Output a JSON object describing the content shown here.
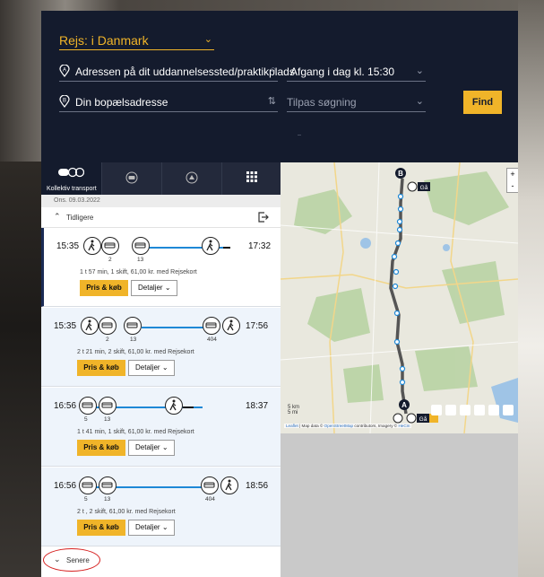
{
  "search": {
    "region_label": "Rejs: i Danmark",
    "from_placeholder": "Adressen på dit uddannelsessted/praktikplads",
    "time_label": "Afgang i dag kl. 15:30",
    "to_placeholder": "Din bopælsadresse",
    "refine_label": "Tilpas søgning",
    "find_label": "Find",
    "pin_a": "A",
    "pin_b": "B"
  },
  "tabs": [
    {
      "label": "Kollektiv transport",
      "icon": "public-transport-icon"
    },
    {
      "label": "",
      "icon": "car-icon"
    },
    {
      "label": "",
      "icon": "car-share-icon"
    },
    {
      "label": "",
      "icon": "grid-icon"
    }
  ],
  "date": "Ons. 09.03.2022",
  "earlier_label": "Tidligere",
  "later_label": "Senere",
  "trips": [
    {
      "dep": "15:35",
      "arr": "17:32",
      "nums": [
        "2",
        "13"
      ],
      "info": "1 t 57 min, 1 skift, 61,00 kr. med Rejsekort",
      "buy": "Pris & køb",
      "details": "Detaljer"
    },
    {
      "dep": "15:35",
      "arr": "17:56",
      "nums": [
        "2",
        "13",
        "404"
      ],
      "info": "2 t 21 min, 2 skift, 61,00 kr. med Rejsekort",
      "buy": "Pris & køb",
      "details": "Detaljer"
    },
    {
      "dep": "16:56",
      "arr": "18:37",
      "nums": [
        "5",
        "13"
      ],
      "info": "1 t 41 min, 1 skift, 61,00 kr. med Rejsekort",
      "buy": "Pris & køb",
      "details": "Detaljer"
    },
    {
      "dep": "16:56",
      "arr": "18:56",
      "nums": [
        "5",
        "13",
        "404"
      ],
      "info": "2 t , 2 skift, 61,00 kr. med Rejsekort",
      "buy": "Pris & køb",
      "details": "Detaljer"
    }
  ],
  "map": {
    "zoom_in": "+",
    "zoom_out": "-",
    "scale_top": "5 km",
    "scale_bottom": "5 mi",
    "marker_a": "A",
    "marker_b": "B",
    "walk_label": "Gå",
    "attribution_leaflet": "Leaflet",
    "attribution_text": " | Map data © ",
    "attribution_osm": "OpenStreetMap",
    "attribution_rest": " contributors, Imagery © ",
    "attribution_here": "HeCm"
  },
  "colors": {
    "accent": "#f0b429",
    "panel": "#141b2d",
    "route": "#1e88d6",
    "annotation": "#d6201f"
  }
}
